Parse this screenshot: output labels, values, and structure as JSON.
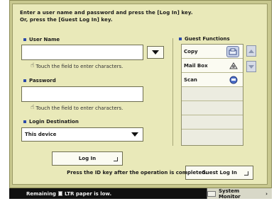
{
  "instructions": {
    "line1": "Enter a user name and password and press the [Log In] key.",
    "line2": "Or, press the [Guest Log In] key."
  },
  "user_name": {
    "label": "User Name",
    "value": "",
    "hint": "Touch the field to enter characters."
  },
  "password": {
    "label": "Password",
    "value": "",
    "hint": "Touch the field to enter characters."
  },
  "login_destination": {
    "label": "Login Destination",
    "selected": "This device"
  },
  "buttons": {
    "login": "Log In",
    "guest_login": "Guest Log In"
  },
  "footer_message": "Press the ID key after the operation is completed.",
  "guest_functions": {
    "title": "Guest Functions",
    "items": [
      {
        "label": "Copy",
        "icon": "copy-icon"
      },
      {
        "label": "Mail Box",
        "icon": "mailbox-icon"
      },
      {
        "label": "Scan",
        "icon": "scan-icon"
      }
    ]
  },
  "status_bar": {
    "message_prefix": "Remaining",
    "message_suffix": "LTR paper is low.",
    "system_monitor": "System Monitor"
  },
  "colors": {
    "panel_bg": "#e9e9b9",
    "accent_bullet": "#2c4aa8",
    "status_bar": "#101010"
  }
}
